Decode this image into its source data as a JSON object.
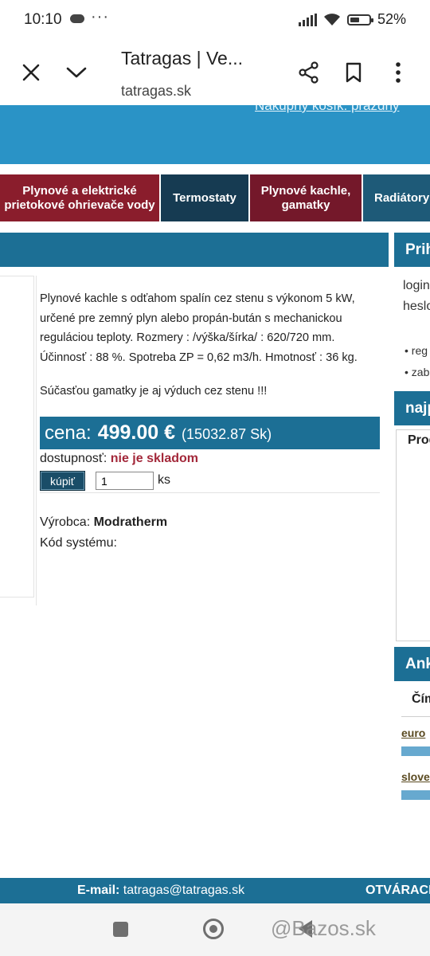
{
  "status_bar": {
    "time": "10:10",
    "more": "···",
    "battery": "52%",
    "battery_level": 0.52
  },
  "browser": {
    "title": "Tatragas | Ve...",
    "url": "tatragas.sk"
  },
  "header": {
    "cart_link": "Nákupný košík: prázdny"
  },
  "nav": {
    "items": [
      {
        "label": "Plynové a elektrické prietokové ohrievače vody"
      },
      {
        "label": "Termostaty"
      },
      {
        "label": "Plynové kachle, gamatky"
      },
      {
        "label": "Radiátory"
      }
    ]
  },
  "product": {
    "description": "Plynové kachle s odťahom spalín cez stenu s výkonom 5 kW, určené pre zemný plyn alebo propán-bután s mechanickou reguláciou teploty. Rozmery : /výška/šírka/ : 620/720 mm. Účinnosť : 88 %. Spotreba ZP = 0,62 m3/h. Hmotnosť : 36 kg.",
    "note": "Súčasťou gamatky je aj výduch cez stenu !!!",
    "price_label": "cena:",
    "price": "499.00 €",
    "price_sk": "(15032.87 Sk)",
    "availability_label": "dostupnosť:",
    "availability": "nie je skladom",
    "buy_label": "kúpiť",
    "quantity": "1",
    "quantity_unit": "ks",
    "maker_label": "Výrobca:",
    "maker": "Modratherm",
    "code_label": "Kód systému:",
    "code": ""
  },
  "sidebar": {
    "login_title": "Prih",
    "login_text": "login",
    "password_text": "heslo",
    "link_1": "• reg",
    "link_2": "• zab",
    "search_title": "najp",
    "box_title": "Prod",
    "poll_title": "Anke",
    "poll_question": "Čím",
    "poll_option_1": "euro",
    "poll_option_2": "slove"
  },
  "footer": {
    "email_label": "E-mail:",
    "email": "tatragas@tatragas.sk",
    "hours": "OTVÁRACI"
  },
  "watermark": "@Bazos.sk",
  "icons": {
    "close": "close-icon",
    "chevron": "chevron-down-icon",
    "share": "share-icon",
    "bookmark": "bookmark-icon",
    "menu": "more-vert-icon"
  }
}
